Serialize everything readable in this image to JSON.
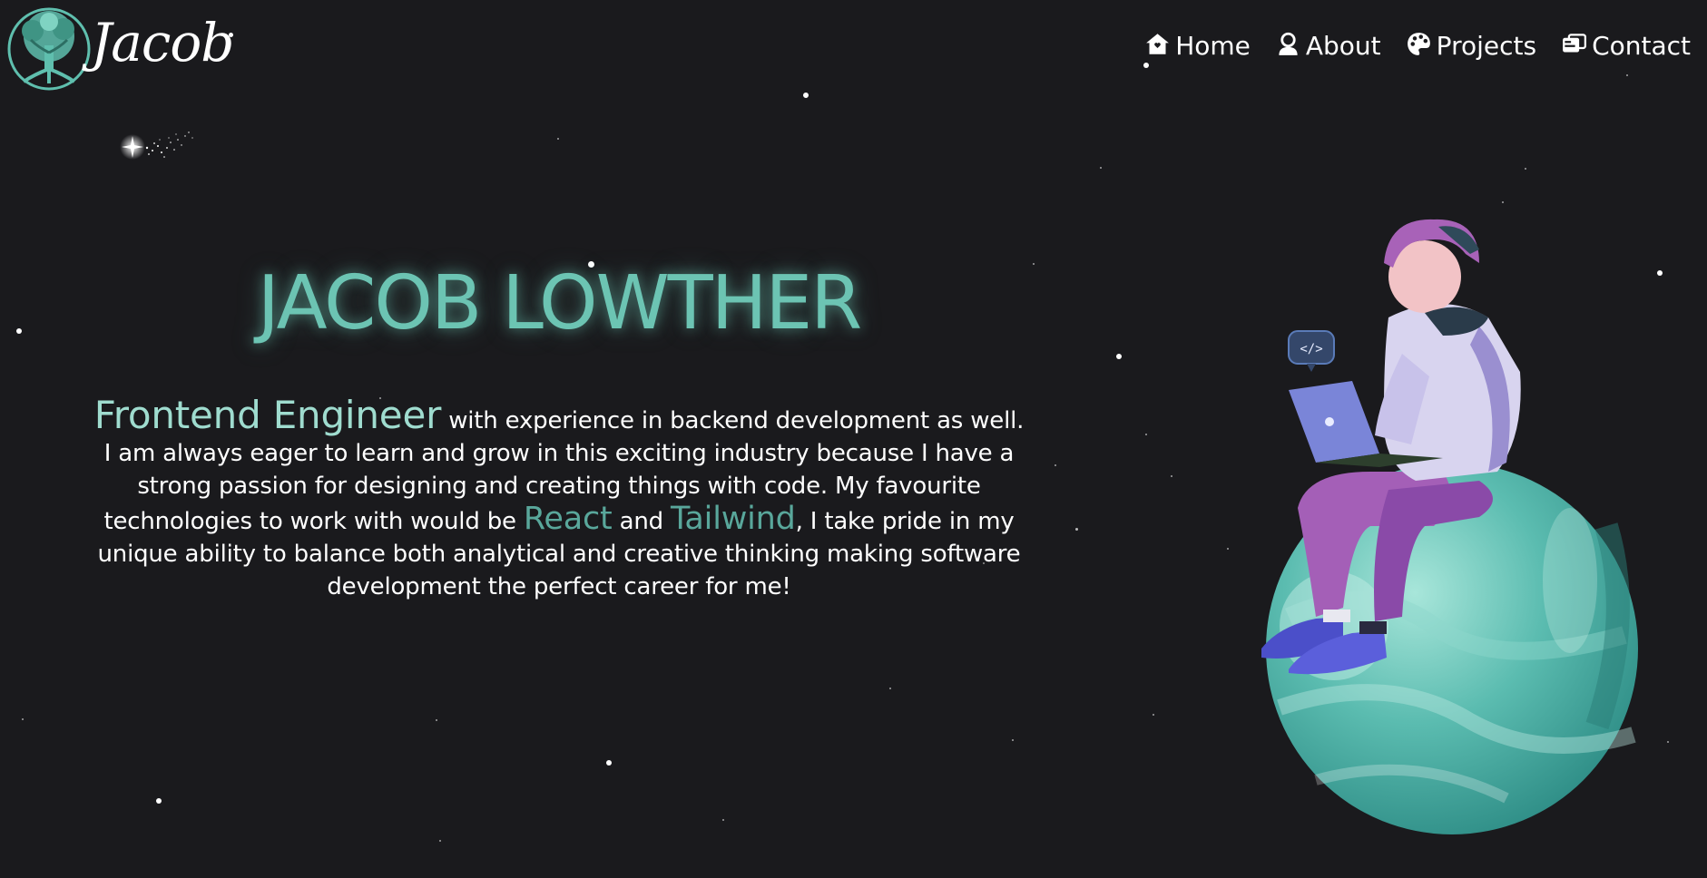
{
  "header": {
    "logo_text": "Jacob",
    "nav": [
      {
        "label": "Home",
        "icon": "house-icon"
      },
      {
        "label": "About",
        "icon": "user-icon"
      },
      {
        "label": "Projects",
        "icon": "palette-icon"
      },
      {
        "label": "Contact",
        "icon": "contact-card-icon"
      }
    ]
  },
  "hero": {
    "name": "JACOB LOWTHER",
    "bio": {
      "role": "Frontend Engineer",
      "part1": " with experience in backend development as well. I am always eager to learn and grow in this exciting industry because I have a strong passion for designing and creating things with code. My favourite technologies to work with would be ",
      "tech1": "React",
      "and": " and ",
      "tech2": "Tailwind",
      "part2": ", I take pride in my unique ability to balance both analytical and creative thinking making software development the perfect career for me!"
    }
  },
  "colors": {
    "background": "#1a1a1d",
    "accent": "#6cc4b3",
    "accent_light": "#9fdccf",
    "accent_dark": "#59a79b"
  },
  "illustration": {
    "subject": "developer-on-planet-illustration",
    "code_bubble": "</>"
  }
}
